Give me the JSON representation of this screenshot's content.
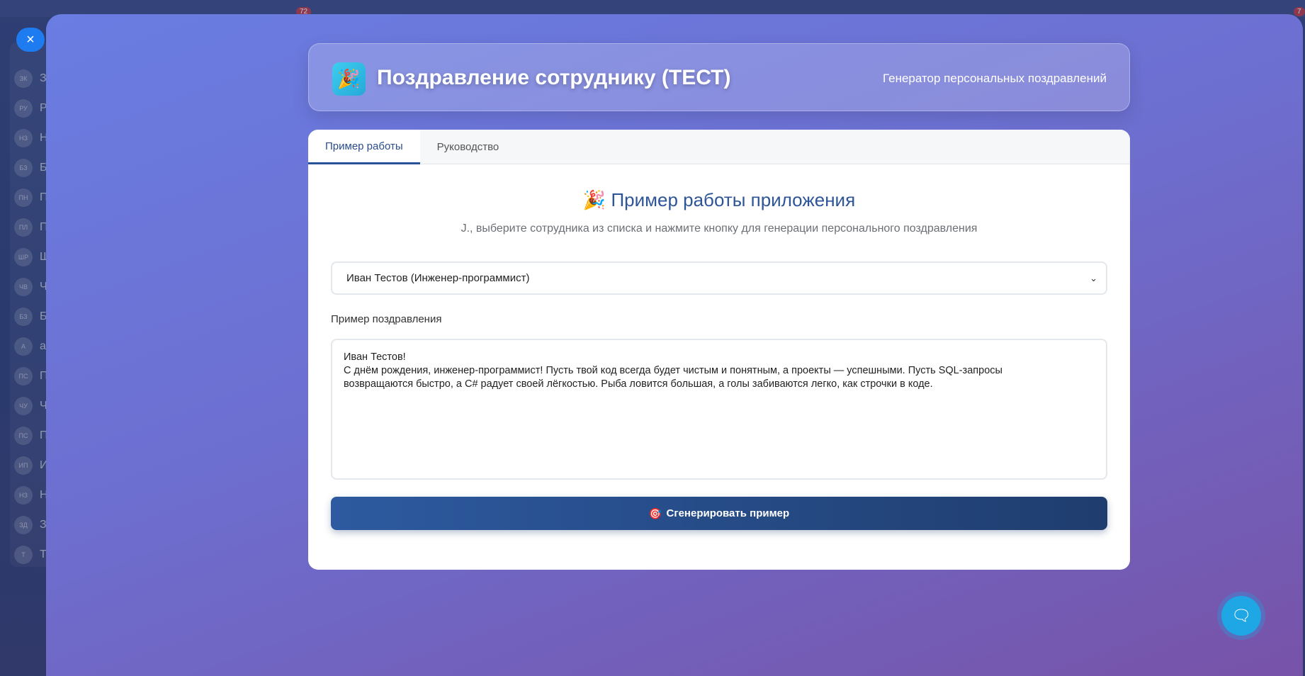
{
  "background": {
    "badges": [
      "72",
      "7"
    ],
    "sidebar_items": [
      {
        "abbr": "ЗК",
        "letter": "З"
      },
      {
        "abbr": "РУ",
        "letter": "Р"
      },
      {
        "abbr": "НЗ",
        "letter": "Н"
      },
      {
        "abbr": "БЗ",
        "letter": "Б"
      },
      {
        "abbr": "ПН",
        "letter": "П"
      },
      {
        "abbr": "ПЛ",
        "letter": "П"
      },
      {
        "abbr": "ШР",
        "letter": "Ш"
      },
      {
        "abbr": "ЧВ",
        "letter": "Ч"
      },
      {
        "abbr": "БЗ",
        "letter": "Б"
      },
      {
        "abbr": "А",
        "letter": "а"
      },
      {
        "abbr": "ПС",
        "letter": "П"
      },
      {
        "abbr": "ЧУ",
        "letter": "Ч"
      },
      {
        "abbr": "ПС",
        "letter": "П"
      },
      {
        "abbr": "ИП",
        "letter": "И"
      },
      {
        "abbr": "НЗ",
        "letter": "Н"
      },
      {
        "abbr": "ЗД",
        "letter": "З"
      },
      {
        "abbr": "Т",
        "letter": "Т"
      }
    ]
  },
  "close_icon": "×",
  "header": {
    "icon": "🎉",
    "title": "Поздравление сотруднику (ТЕСТ)",
    "subtitle": "Генератор персональных поздравлений"
  },
  "tabs": [
    {
      "label": "Пример работы",
      "active": true
    },
    {
      "label": "Руководство",
      "active": false
    }
  ],
  "main": {
    "heading_icon": "🎉",
    "heading": "Пример работы приложения",
    "lead": "J., выберите сотрудника из списка и нажмите кнопку для генерации персонального поздравления",
    "employee_select": "Иван Тестов (Инженер-программист)",
    "textarea_label": "Пример поздравления",
    "textarea_value": "Иван Тестов!\nС днём рождения, инженер-программист! Пусть твой код всегда будет чистым и понятным, а проекты — успешными. Пусть SQL-запросы\nвозвращаются быстро, а C# радует своей лёгкостью. Рыба ловится большая, а голы забиваются легко, как строчки в коде.",
    "generate_icon": "🎯",
    "generate_button": "Сгенерировать пример"
  },
  "colors": {
    "accent": "#2d5597",
    "chat": "#1ea7e4"
  }
}
